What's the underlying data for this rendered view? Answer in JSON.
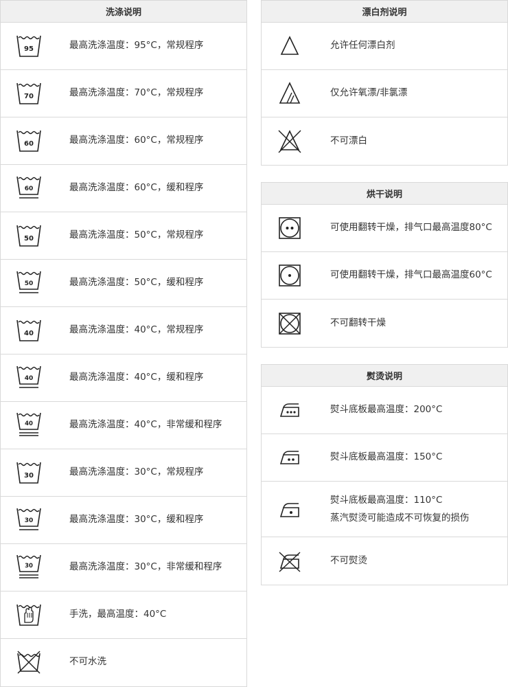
{
  "wash": {
    "title": "洗涤说明",
    "items": [
      {
        "label": "最高洗涤温度：95°C，常规程序",
        "temp": "95"
      },
      {
        "label": "最高洗涤温度：70°C，常规程序",
        "temp": "70"
      },
      {
        "label": "最高洗涤温度：60°C，常规程序",
        "temp": "60"
      },
      {
        "label": "最高洗涤温度：60°C，缓和程序",
        "temp": "60"
      },
      {
        "label": "最高洗涤温度：50°C，常规程序",
        "temp": "50"
      },
      {
        "label": "最高洗涤温度：50°C，缓和程序",
        "temp": "50"
      },
      {
        "label": "最高洗涤温度：40°C，常规程序",
        "temp": "40"
      },
      {
        "label": "最高洗涤温度：40°C，缓和程序",
        "temp": "40"
      },
      {
        "label": "最高洗涤温度：40°C，非常缓和程序",
        "temp": "40"
      },
      {
        "label": "最高洗涤温度：30°C，常规程序",
        "temp": "30"
      },
      {
        "label": "最高洗涤温度：30°C，缓和程序",
        "temp": "30"
      },
      {
        "label": "最高洗涤温度：30°C，非常缓和程序",
        "temp": "30"
      },
      {
        "label": "手洗，最高温度：40°C"
      },
      {
        "label": "不可水洗"
      }
    ]
  },
  "bleach": {
    "title": "漂白剂说明",
    "items": [
      {
        "label": "允许任何漂白剂"
      },
      {
        "label": "仅允许氧漂/非氯漂"
      },
      {
        "label": "不可漂白"
      }
    ]
  },
  "dry": {
    "title": "烘干说明",
    "items": [
      {
        "label": "可使用翻转干燥，排气口最高温度80°C"
      },
      {
        "label": "可使用翻转干燥，排气口最高温度60°C"
      },
      {
        "label": "不可翻转干燥"
      }
    ]
  },
  "iron": {
    "title": "熨烫说明",
    "items": [
      {
        "label": "熨斗底板最高温度：200°C"
      },
      {
        "label": "熨斗底板最高温度：150°C"
      },
      {
        "label": "熨斗底板最高温度：110°C",
        "label2": "蒸汽熨烫可能造成不可恢复的损伤"
      },
      {
        "label": "不可熨烫"
      }
    ]
  }
}
